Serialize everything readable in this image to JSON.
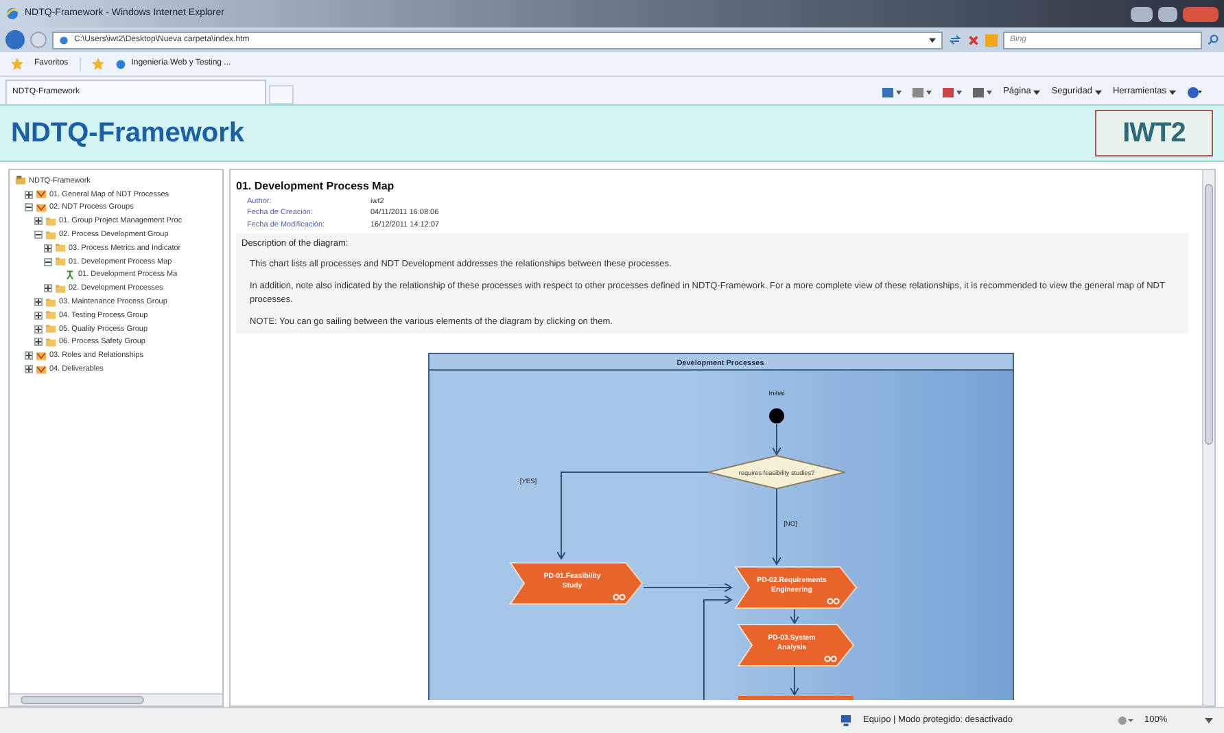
{
  "window": {
    "title": "NDTQ-Framework - Windows Internet Explorer"
  },
  "address_bar": {
    "url": "C:\\Users\\iwt2\\Desktop\\Nueva carpeta\\index.htm",
    "search_placeholder": "Bing"
  },
  "favorites_bar": {
    "label": "Favoritos",
    "links": [
      "Ingeniería Web y Testing ..."
    ]
  },
  "tabs": [
    {
      "label": "NDTQ-Framework",
      "selected": true
    }
  ],
  "command_bar": {
    "menus": [
      "Página",
      "Seguridad",
      "Herramientas"
    ]
  },
  "header": {
    "title": "NDTQ-Framework",
    "logo": "IWT2"
  },
  "tree": [
    {
      "label": "NDTQ-Framework",
      "kind": "root",
      "children": [
        {
          "label": "01. General Map of NDT Processes",
          "kind": "package",
          "expanded": false
        },
        {
          "label": "02. NDT Process Groups",
          "kind": "package",
          "expanded": true,
          "children": [
            {
              "label": "01. Group Project Management Proc",
              "kind": "folder",
              "expanded": false
            },
            {
              "label": "02. Process Development Group",
              "kind": "folder",
              "expanded": true,
              "children": [
                {
                  "label": "03. Process Metrics and Indicator",
                  "kind": "folder",
                  "expanded": false
                },
                {
                  "label": "01. Development Process Map",
                  "kind": "folder",
                  "expanded": true,
                  "children": [
                    {
                      "label": "01. Development Process Ma",
                      "kind": "diagram"
                    }
                  ]
                },
                {
                  "label": "02. Development Processes",
                  "kind": "folder",
                  "expanded": false
                }
              ]
            },
            {
              "label": "03. Maintenance Process Group",
              "kind": "folder",
              "expanded": false
            },
            {
              "label": "04. Testing Process Group",
              "kind": "folder",
              "expanded": false
            },
            {
              "label": "05. Quality Process Group",
              "kind": "folder",
              "expanded": false
            },
            {
              "label": "06. Process Safety Group",
              "kind": "folder",
              "expanded": false
            }
          ]
        },
        {
          "label": "03. Roles and Relationships",
          "kind": "package",
          "expanded": false
        },
        {
          "label": "04. Deliverables",
          "kind": "package",
          "expanded": false
        }
      ]
    }
  ],
  "document": {
    "title": "01. Development Process Map",
    "meta": [
      {
        "label": "Author:",
        "value": "iwt2"
      },
      {
        "label": "Fecha de Creación:",
        "value": "04/11/2011 16:08:06"
      },
      {
        "label": "Fecha de Modificación:",
        "value": "16/12/2011 14:12:07"
      }
    ],
    "description_heading": "Description of the diagram:",
    "paragraphs": [
      "This chart lists all processes and NDT Development addresses the relationships between these processes.",
      "In addition, note also indicated by the relationship of these processes with respect to other processes defined in NDTQ-Framework. For a more complete view of these relationships, it is recommended to view the general map of NDT processes.",
      "NOTE: You can go sailing between the various elements of the diagram by clicking on them."
    ]
  },
  "diagram": {
    "title": "Development Processes",
    "initial_label": "Initial",
    "decision": "requires feasibility studies?",
    "guards": [
      "[YES]",
      "[NO]"
    ],
    "processes": [
      {
        "label": "PD-01.Feasibility Study"
      },
      {
        "label": "PD-02.Requirements Engineering"
      },
      {
        "label": "PD-03.System Analysis"
      }
    ]
  },
  "status_bar": {
    "zone": "Equipo | Modo protegido: desactivado",
    "zoom": "100%"
  }
}
